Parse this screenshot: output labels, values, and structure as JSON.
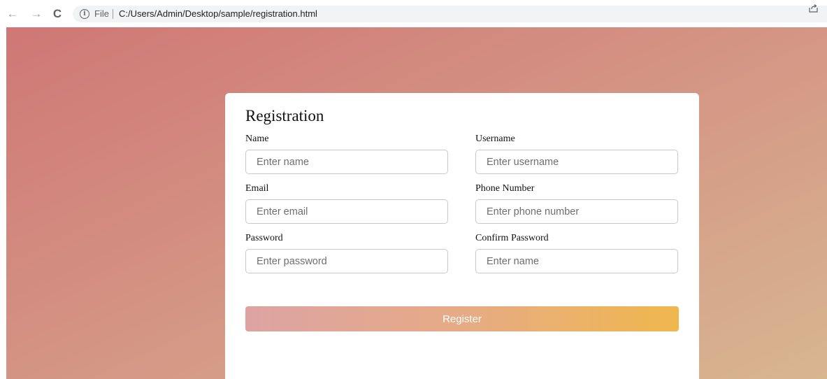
{
  "browser": {
    "back_icon": "←",
    "forward_icon": "→",
    "reload_icon": "C",
    "info_icon": "i",
    "file_label": "File",
    "url": "C:/Users/Admin/Desktop/sample/registration.html",
    "share_icon": "share-icon"
  },
  "form": {
    "title": "Registration",
    "fields": [
      {
        "label": "Name",
        "placeholder": "Enter name",
        "value": ""
      },
      {
        "label": "Username",
        "placeholder": "Enter username",
        "value": ""
      },
      {
        "label": "Email",
        "placeholder": "Enter email",
        "value": ""
      },
      {
        "label": "Phone Number",
        "placeholder": "Enter phone number",
        "value": ""
      },
      {
        "label": "Password",
        "placeholder": "Enter password",
        "value": ""
      },
      {
        "label": "Confirm Password",
        "placeholder": "Enter name",
        "value": ""
      }
    ],
    "submit_label": "Register"
  },
  "colors": {
    "background_start": "#cf7775",
    "background_end": "#d8b690",
    "button_start": "#dca3a3",
    "button_end": "#f0b74e"
  }
}
